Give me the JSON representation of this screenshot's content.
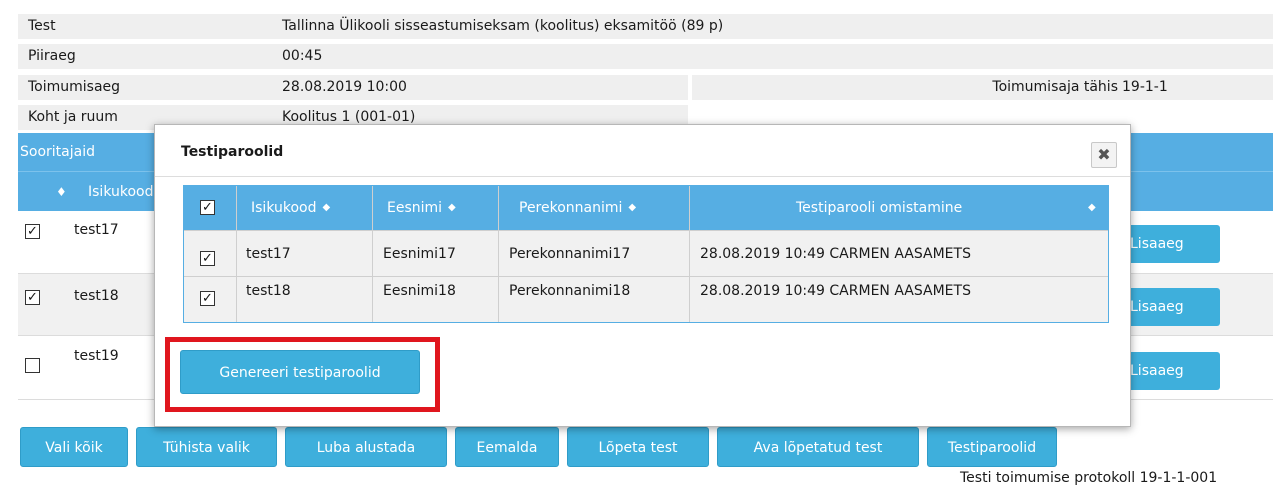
{
  "info": {
    "test_label": "Test",
    "test_value": "Tallinna Ülikooli sisseastumiseksam (koolitus) eksamitöö (89 p)",
    "time_limit_label": "Piiraeg",
    "time_limit_value": "00:45",
    "date_label": "Toimumisaeg",
    "date_value": "28.08.2019 10:00",
    "date_code_label": "Toimumisaja tähis",
    "date_code_value": "19-1-1",
    "place_label": "Koht ja ruum",
    "place_value": "Koolitus 1 (001-01)"
  },
  "participants": {
    "section_label": "Sooritajaid",
    "col_sort": "♦",
    "col_isikukood": "Isikukood",
    "rows": [
      {
        "id": "test17",
        "checked": "✓",
        "button": "Lisaaeg"
      },
      {
        "id": "test18",
        "checked": "✓",
        "button": "Lisaaeg"
      },
      {
        "id": "test19",
        "checked": "",
        "button": "Lisaaeg"
      }
    ]
  },
  "modal": {
    "title": "Testiparoolid",
    "close_glyph": "✖",
    "header_check": "✓",
    "columns": {
      "isikukood": "Isikukood",
      "eesnimi": "Eesnimi",
      "perekonnanimi": "Perekonnanimi",
      "omistamine": "Testiparooli omistamine"
    },
    "sort_glyph": "◆",
    "rows": [
      {
        "check": "✓",
        "isikukood": "test17",
        "eesnimi": "Eesnimi17",
        "perekonnanimi": "Perekonnanimi17",
        "omistamine": "28.08.2019 10:49 CARMEN AASAMETS"
      },
      {
        "check": "✓",
        "isikukood": "test18",
        "eesnimi": "Eesnimi18",
        "perekonnanimi": "Perekonnanimi18",
        "omistamine": "28.08.2019 10:49 CARMEN AASAMETS"
      }
    ],
    "generate_button": "Genereeri testiparoolid"
  },
  "toolbar": {
    "select_all": "Vali kõik",
    "clear_selection": "Tühista valik",
    "allow_start": "Luba alustada",
    "remove": "Eemalda",
    "finish_test": "Lõpeta test",
    "open_finished": "Ava lõpetatud test",
    "passwords": "Testiparoolid"
  },
  "footer": {
    "protocol": "Testi toimumise protokoll 19-1-1-001"
  },
  "colors": {
    "header_blue": "#56aee3",
    "button_blue": "#3eafdc",
    "highlight_red": "#e0161e",
    "row_gray": "#efefef"
  }
}
